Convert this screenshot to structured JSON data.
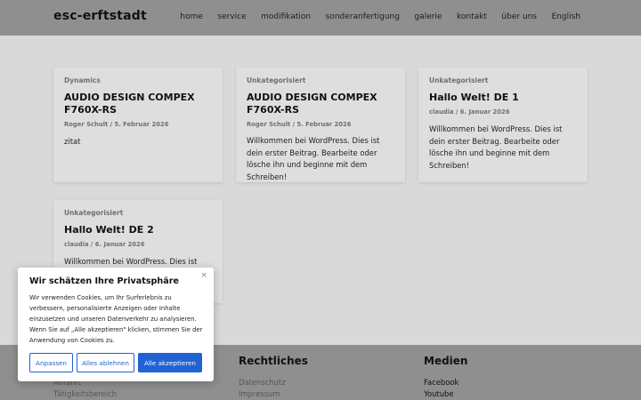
{
  "header": {
    "logo": "esc-erftstadt",
    "nav": [
      "home",
      "service",
      "modifikation",
      "sonderanfertigung",
      "galerie",
      "kontakt",
      "über uns",
      "English"
    ]
  },
  "posts": [
    {
      "category": "Dynamics",
      "title": "AUDIO DESIGN COMPEX F760X-RS",
      "meta": "Roger Schult / 5. Februar 2026",
      "excerpt": "zitat"
    },
    {
      "category": "Unkategorisiert",
      "title": "AUDIO DESIGN COMPEX F760X-RS",
      "meta": "Roger Schult / 5. Februar 2026",
      "excerpt": "Willkommen bei WordPress. Dies ist dein erster Beitrag. Bearbeite oder lösche ihn und beginne mit dem Schreiben!"
    },
    {
      "category": "Unkategorisiert",
      "title": "Hallo Welt! DE 1",
      "meta": "claudia / 6. Januar 2026",
      "excerpt": "Willkommen bei WordPress. Dies ist dein erster Beitrag. Bearbeite oder lösche ihn und beginne mit dem Schreiben!"
    },
    {
      "category": "Unkategorisiert",
      "title": "Hallo Welt! DE 2",
      "meta": "claudia / 6. Januar 2026",
      "excerpt": "Willkommen bei WordPress. Dies ist dein"
    }
  ],
  "footer": {
    "col1_links": [
      "Anfahrt",
      "Tätigkeitsbereich"
    ],
    "col2_title": "Rechtliches",
    "col2_links": [
      "Datenschutz",
      "Impressum"
    ],
    "col3_title": "Medien",
    "col3_links": [
      "Facebook",
      "Youtube"
    ]
  },
  "cookie": {
    "title": "Wir schätzen Ihre Privatsphäre",
    "text": "Wir verwenden Cookies, um Ihr Surferlebnis zu verbessern, personalisierte Anzeigen oder Inhalte einzusetzen und unseren Datenverkehr zu analysieren. Wenn Sie auf „Alle akzeptieren\" klicken, stimmen Sie der Anwendung von Cookies zu.",
    "close": "×",
    "btn_customize": "Anpassen",
    "btn_reject": "Alles ablehnen",
    "btn_accept": "Alle akzeptieren",
    "accent_color": "#1f62d4"
  }
}
